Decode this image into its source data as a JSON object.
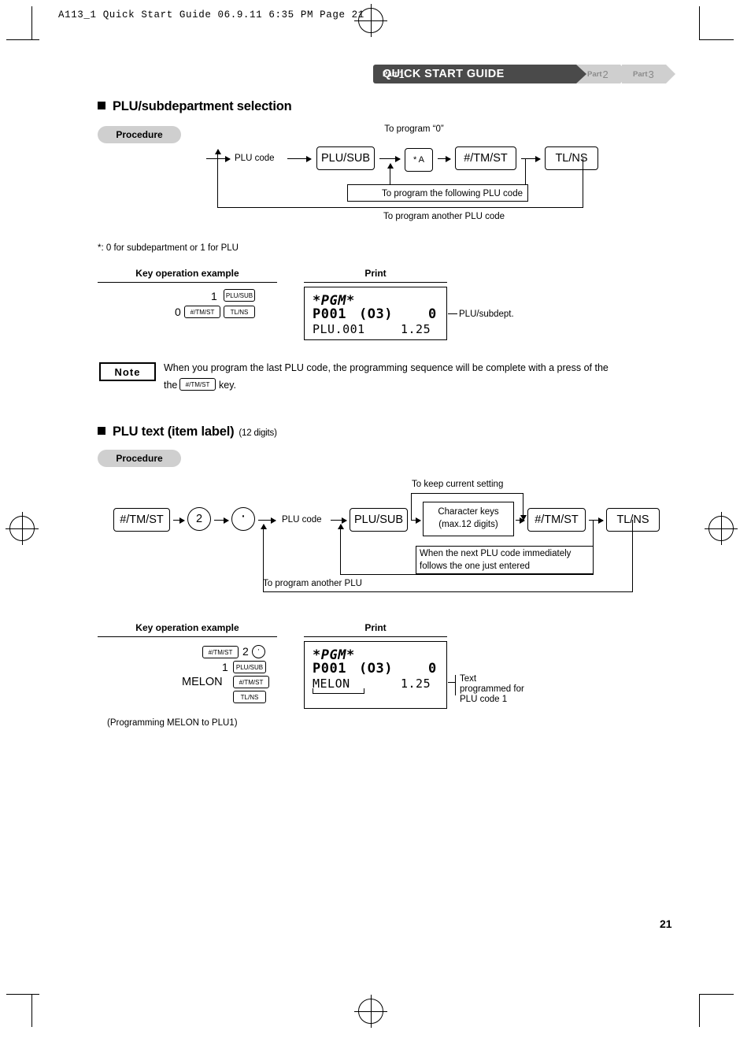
{
  "print_header": "A113_1 Quick Start Guide  06.9.11 6:35 PM  Page 21",
  "header": {
    "part_word": "Part",
    "part_num": "1",
    "title": "QUICK START GUIDE",
    "tab2_word": "Part",
    "tab2_num": "2",
    "tab3_word": "Part",
    "tab3_num": "3"
  },
  "section1": {
    "heading": "PLU/subdepartment selection",
    "procedure_label": "Procedure",
    "flow": {
      "label_plu_code": "PLU code",
      "key_plusub": "PLU/SUB",
      "key_star_a": "* A",
      "key_tmst": "#/TM/ST",
      "key_tlns": "TL/NS",
      "note_zero": "To program “0”",
      "note_following": "To program the following PLU code",
      "note_another": "To program another PLU code"
    },
    "footnote": "*: 0 for subdepartment or 1 for PLU",
    "col_key_example": "Key operation example",
    "col_print": "Print",
    "example": {
      "line1_num": "1",
      "line1_key": "PLU/SUB",
      "line2_num": "0",
      "line2_key1": "#/TM/ST",
      "line2_key2": "TL/NS"
    },
    "receipt": {
      "title": "*PGM*",
      "line1_left": "P001",
      "line1_mid": "(O3)",
      "line1_right": "0",
      "line2_left": "PLU.001",
      "line2_right": "1.25"
    },
    "callout": "PLU/subdept."
  },
  "note": {
    "badge": "Note",
    "text_before": "When you program the last PLU code, the programming sequence will be complete with a press of the",
    "key": "#/TM/ST",
    "text_after": "key."
  },
  "section2": {
    "heading": "PLU text (item label)",
    "heading_suffix": "(12 digits)",
    "procedure_label": "Procedure",
    "flow": {
      "key_tmst": "#/TM/ST",
      "key_two": "2",
      "key_dot": "·",
      "label_plu_code": "PLU code",
      "key_plusub": "PLU/SUB",
      "char_keys_line1": "Character keys",
      "char_keys_line2": "(max.12 digits)",
      "key_tmst2": "#/TM/ST",
      "key_tlns": "TL/NS",
      "note_keep": "To keep current setting",
      "note_next_line1": "When the next PLU code immediately",
      "note_next_line2": "follows the one just entered",
      "note_another": "To program another PLU"
    },
    "col_key_example": "Key operation example",
    "col_print": "Print",
    "example": {
      "line1_key1": "#/TM/ST",
      "line1_num": "2",
      "line1_dot": "·",
      "line2_num": "1",
      "line2_key": "PLU/SUB",
      "line3_text": "MELON",
      "line3_key": "#/TM/ST",
      "line4_key": "TL/NS"
    },
    "receipt": {
      "title": "*PGM*",
      "line1_left": "P001",
      "line1_mid": "(O3)",
      "line1_right": "0",
      "line2_left": "MELON",
      "line2_right": "1.25"
    },
    "callout_line1": "Text",
    "callout_line2": "programmed for",
    "callout_line3": "PLU code 1",
    "caption": "(Programming MELON to PLU1)"
  },
  "page_number": "21"
}
